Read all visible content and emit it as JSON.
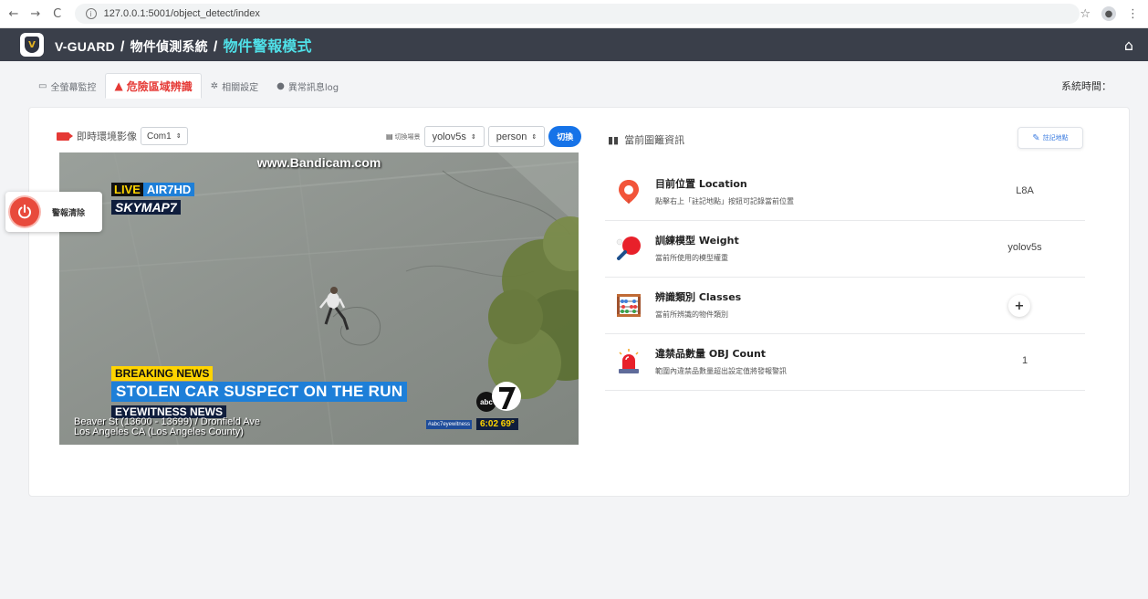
{
  "browser": {
    "url": "127.0.0.1:5001/object_detect/index"
  },
  "header": {
    "brand": "V-GUARD",
    "system": "物件偵測系統",
    "mode": "物件警報模式"
  },
  "tabs": [
    {
      "label": "全螢幕監控"
    },
    {
      "label": "危險區域辨識"
    },
    {
      "label": "相關設定"
    },
    {
      "label": "異常訊息log"
    }
  ],
  "system_time_label": "系統時間：",
  "video": {
    "title": "即時環境影像",
    "camera_select": "Com1",
    "scene_label": "切換場景",
    "model_select": "yolov5s",
    "class_select": "person",
    "switch_button": "切換",
    "overlay": {
      "watermark": "www.Bandicam.com",
      "live": "LIVE",
      "air": "AIR7HD",
      "skymap": "SKYMAP7",
      "breaking": "BREAKING NEWS",
      "headline": "STOLEN CAR SUSPECT ON THE RUN",
      "eyewitness": "EYEWITNESS NEWS",
      "address_line1": "Beaver St (13600 - 13699) / Dronfield Ave",
      "address_line2": "Los Angeles CA (Los Angeles County)",
      "hashtag": "#abc7eyewitness",
      "time": "6:02",
      "temp": "69°",
      "logo": "abc"
    }
  },
  "alarm": {
    "label": "警報清除",
    "color": "#e84a3c"
  },
  "info_panel": {
    "title": "當前圖籬資訊",
    "mark_button": "註記地點",
    "rows": [
      {
        "name": "目前位置 Location",
        "desc": "點擊右上「註記地點」按鈕可記錄當前位置",
        "value": "L8A",
        "icon": "location-pin-icon"
      },
      {
        "name": "訓練模型 Weight",
        "desc": "當前所使用的模型權重",
        "value": "yolov5s",
        "icon": "ping-pong-icon"
      },
      {
        "name": "辨識類別 Classes",
        "desc": "當前所辨識的物件類別",
        "value": "",
        "icon": "abacus-icon"
      },
      {
        "name": "違禁品數量 OBJ Count",
        "desc": "範圍內違禁品數量超出設定值將發報警訊",
        "value": "1",
        "icon": "siren-icon"
      }
    ],
    "add_symbol": "+"
  },
  "colors": {
    "header_bg": "#3a3f4a",
    "mode_accent": "#4fe0e8",
    "active_tab": "#e53935",
    "primary": "#1673e8"
  }
}
